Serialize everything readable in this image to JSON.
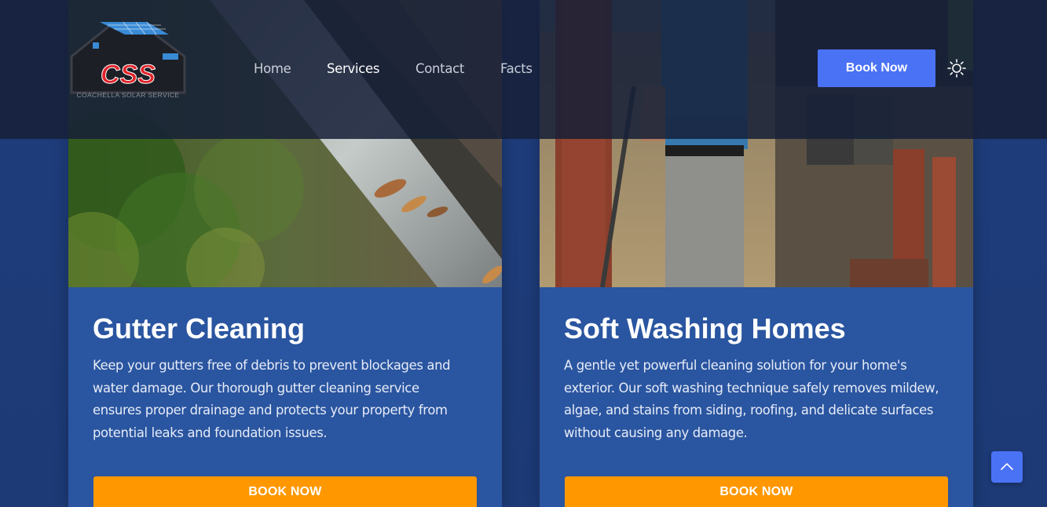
{
  "header": {
    "logo": {
      "letters": "CSS",
      "tagline": "COACHELLA SOLAR SERVICE"
    },
    "nav": [
      {
        "label": "Home",
        "active": false
      },
      {
        "label": "Services",
        "active": true
      },
      {
        "label": "Contact",
        "active": false
      },
      {
        "label": "Facts",
        "active": false
      }
    ],
    "book_label": "Book Now",
    "theme_icon": "sun-icon"
  },
  "services": [
    {
      "title": "Gutter Cleaning",
      "description": "Keep your gutters free of debris to prevent blockages and water damage. Our thorough gutter cleaning service ensures proper drainage and protects your property from potential leaks and foundation issues.",
      "button": "BOOK NOW"
    },
    {
      "title": "Soft Washing Homes",
      "description": "A gentle yet powerful cleaning solution for your home's exterior. Our soft washing technique safely removes mildew, algae, and stains from siding, roofing, and delicate surfaces without causing any damage.",
      "button": "BOOK NOW"
    }
  ],
  "scroll_top_icon": "chevron-up-icon",
  "colors": {
    "accent": "#4a72f5",
    "button_orange": "#ff9800",
    "card_bg": "#2a55a0",
    "page_bg": "#1d3b78",
    "header_bg": "#162038"
  }
}
